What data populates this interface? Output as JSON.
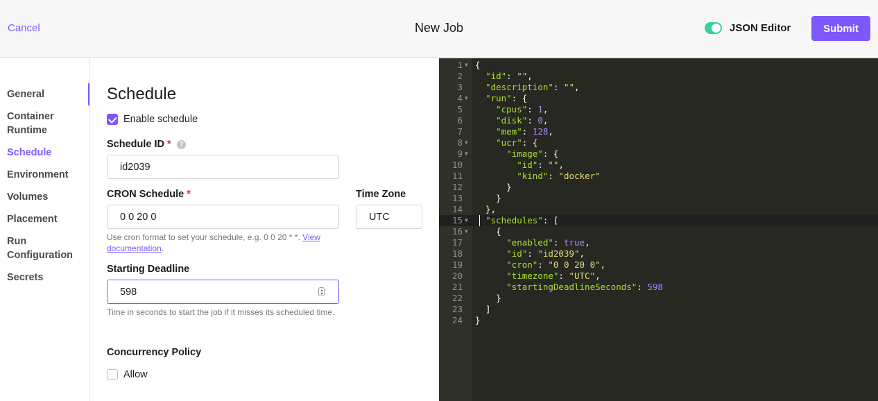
{
  "header": {
    "cancel_label": "Cancel",
    "title": "New Job",
    "json_editor_label": "JSON Editor",
    "json_editor_enabled": true,
    "submit_label": "Submit"
  },
  "sidebar": {
    "items": [
      {
        "label": "General",
        "active": false
      },
      {
        "label": "Container Runtime",
        "active": false
      },
      {
        "label": "Schedule",
        "active": true
      },
      {
        "label": "Environment",
        "active": false
      },
      {
        "label": "Volumes",
        "active": false
      },
      {
        "label": "Placement",
        "active": false
      },
      {
        "label": "Run Configuration",
        "active": false
      },
      {
        "label": "Secrets",
        "active": false
      }
    ]
  },
  "form": {
    "title": "Schedule",
    "enable_schedule": {
      "label": "Enable schedule",
      "checked": true
    },
    "schedule_id": {
      "label": "Schedule ID",
      "required_mark": "*",
      "value": "id2039"
    },
    "cron": {
      "label": "CRON Schedule",
      "required_mark": "*",
      "value": "0 0 20 0",
      "help": "Use cron format to set your schedule, e.g. 0 0 20 * *.",
      "help_link": "View documentation"
    },
    "timezone": {
      "label": "Time Zone",
      "value": "UTC"
    },
    "starting_deadline": {
      "label": "Starting Deadline",
      "value": "598",
      "help": "Time in seconds to start the job if it misses its scheduled time."
    },
    "concurrency": {
      "label": "Concurrency Policy",
      "allow_label": "Allow",
      "allow_checked": false
    }
  },
  "editor": {
    "highlighted_line": 15,
    "lines": [
      "{",
      "  \"id\": \"\",",
      "  \"description\": \"\",",
      "  \"run\": {",
      "    \"cpus\": 1,",
      "    \"disk\": 0,",
      "    \"mem\": 128,",
      "    \"ucr\": {",
      "      \"image\": {",
      "        \"id\": \"\",",
      "        \"kind\": \"docker\"",
      "      }",
      "    }",
      "  },",
      "  \"schedules\": [",
      "    {",
      "      \"enabled\": true,",
      "      \"id\": \"id2039\",",
      "      \"cron\": \"0 0 20 0\",",
      "      \"timezone\": \"UTC\",",
      "      \"startingDeadlineSeconds\": 598",
      "    }",
      "  ]",
      "}"
    ],
    "fold_lines": [
      1,
      4,
      8,
      9,
      15,
      16
    ]
  },
  "colors": {
    "accent": "#7d58ff",
    "toggle_on": "#2ed39f",
    "required": "#e0273b",
    "editor_bg": "#272822",
    "json_key": "#a6e22e",
    "json_string": "#e6db74",
    "json_number": "#ae81ff"
  }
}
